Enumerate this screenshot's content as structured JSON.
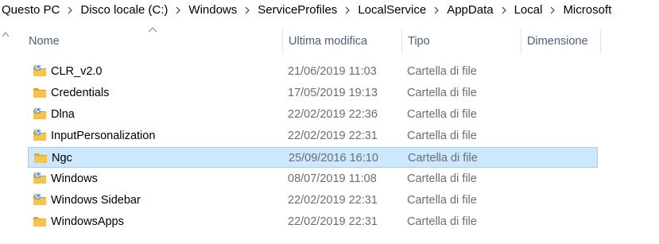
{
  "breadcrumb": [
    "Questo PC",
    "Disco locale (C:)",
    "Windows",
    "ServiceProfiles",
    "LocalService",
    "AppData",
    "Local",
    "Microsoft"
  ],
  "columns": {
    "name": "Nome",
    "modified": "Ultima modifica",
    "type": "Tipo",
    "size": "Dimensione"
  },
  "colors": {
    "folder": "#f8c34b",
    "folder_dark": "#e3a21a",
    "shortcut_badge": "#3b7bd5",
    "selected_bg": "#cce8ff",
    "selected_border": "#99d1ff",
    "header_text": "#4c607a",
    "detail_text": "#6d6d6d"
  },
  "rows": [
    {
      "name": "CLR_v2.0",
      "modified": "21/06/2019 11:03",
      "type": "Cartella di file",
      "size": "",
      "icon": "folder-shortcut-icon"
    },
    {
      "name": "Credentials",
      "modified": "17/05/2019 19:13",
      "type": "Cartella di file",
      "size": "",
      "icon": "folder-icon"
    },
    {
      "name": "Dlna",
      "modified": "22/02/2019 22:36",
      "type": "Cartella di file",
      "size": "",
      "icon": "folder-shortcut-icon"
    },
    {
      "name": "InputPersonalization",
      "modified": "22/02/2019 22:31",
      "type": "Cartella di file",
      "size": "",
      "icon": "folder-shortcut-icon"
    },
    {
      "name": "Ngc",
      "modified": "25/09/2016 16:10",
      "type": "Cartella di file",
      "size": "",
      "icon": "folder-icon",
      "selected": true
    },
    {
      "name": "Windows",
      "modified": "08/07/2019 11:08",
      "type": "Cartella di file",
      "size": "",
      "icon": "folder-shortcut-icon"
    },
    {
      "name": "Windows Sidebar",
      "modified": "22/02/2019 22:31",
      "type": "Cartella di file",
      "size": "",
      "icon": "folder-shortcut-icon"
    },
    {
      "name": "WindowsApps",
      "modified": "22/02/2019 22:31",
      "type": "Cartella di file",
      "size": "",
      "icon": "folder-icon"
    }
  ]
}
